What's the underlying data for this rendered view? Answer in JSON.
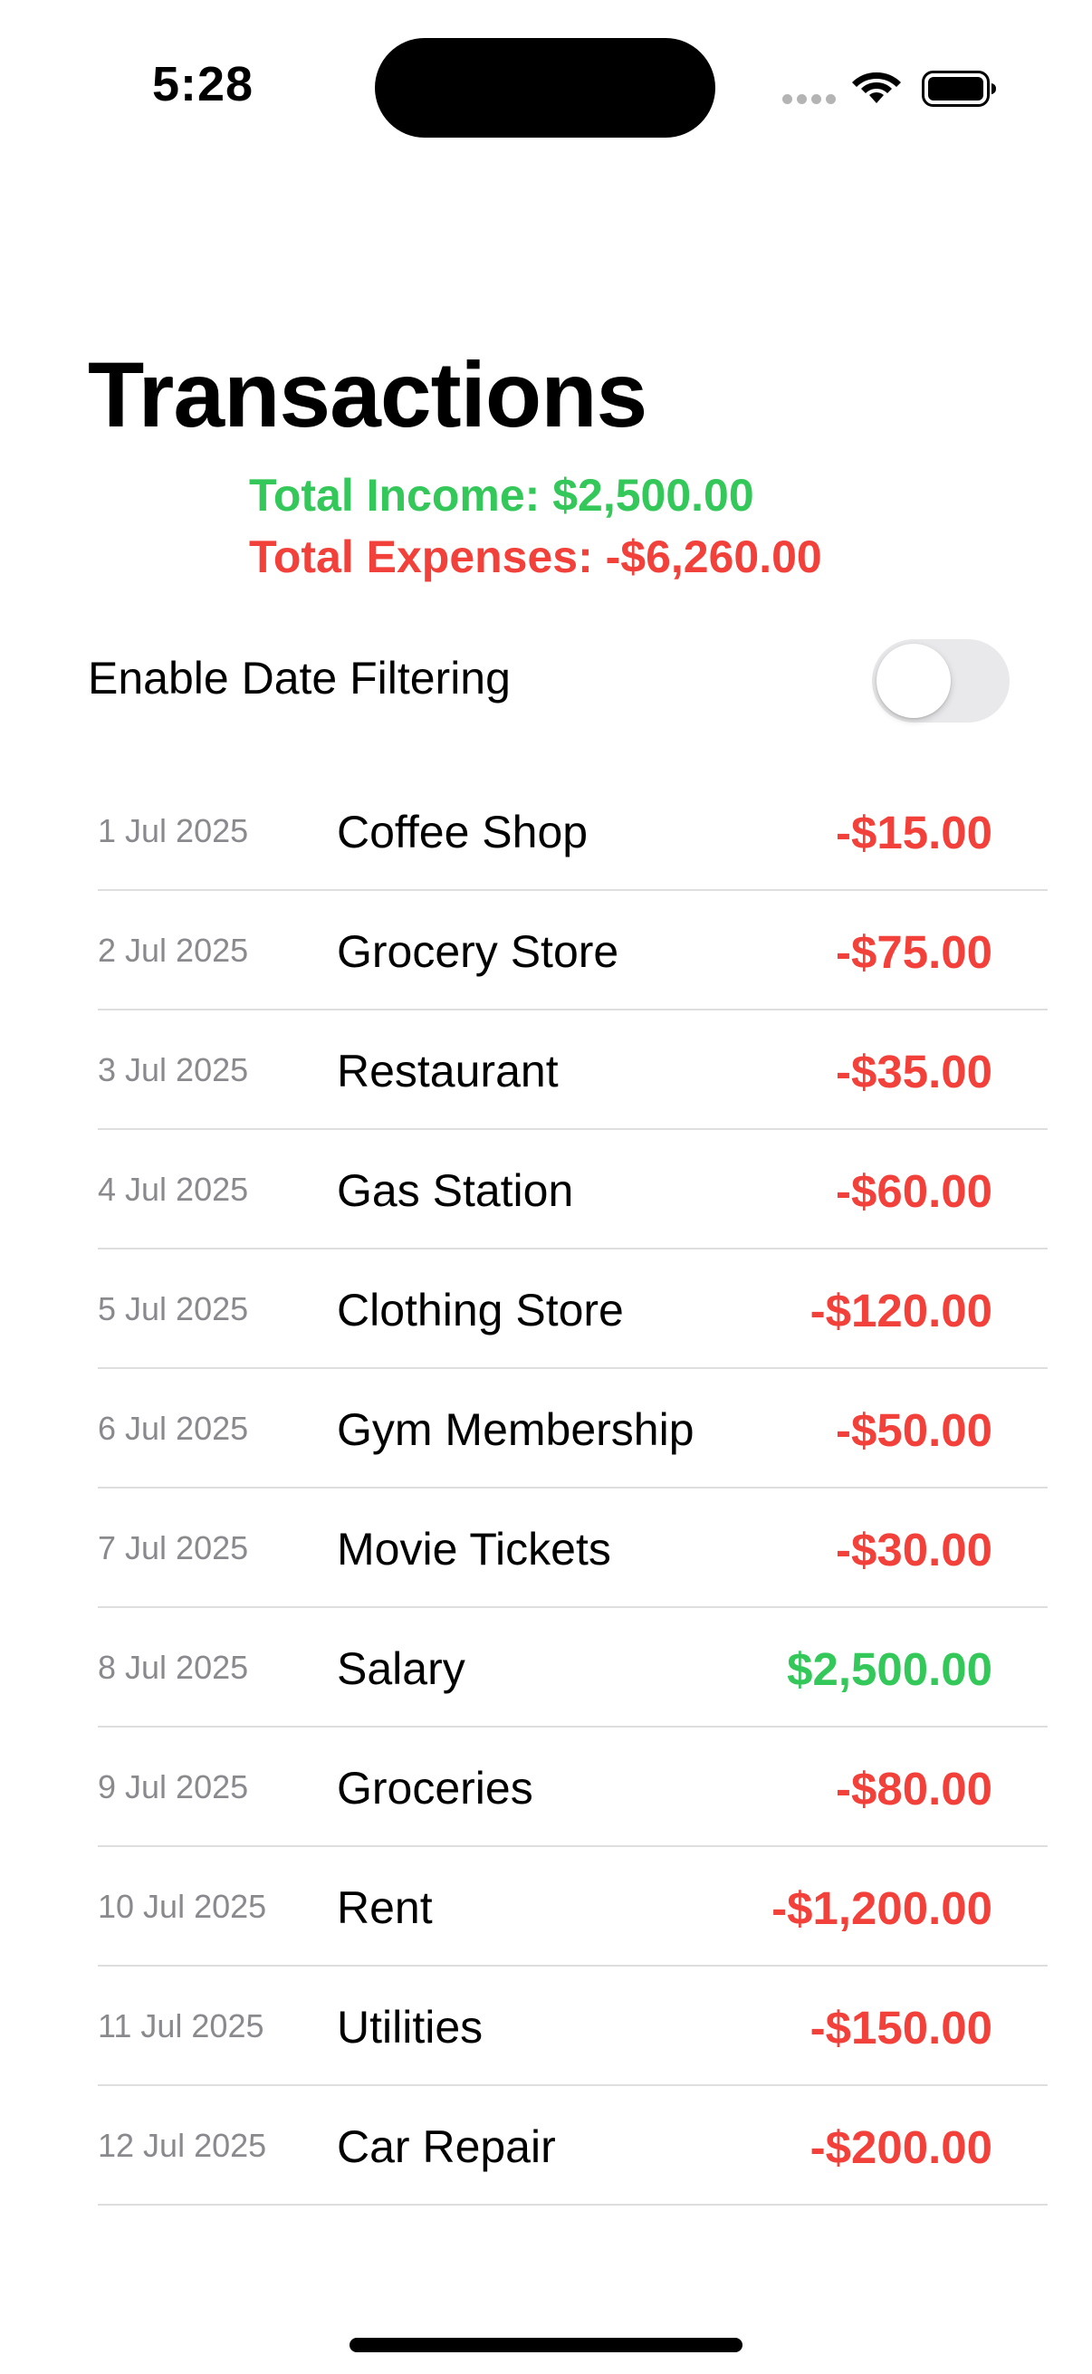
{
  "status_bar": {
    "time": "5:28",
    "icons": [
      "signal-dots-icon",
      "wifi-icon",
      "battery-icon"
    ]
  },
  "header": {
    "title": "Transactions",
    "total_income": "Total Income: $2,500.00",
    "total_expenses": "Total Expenses: -$6,260.00"
  },
  "filter": {
    "label": "Enable Date Filtering",
    "enabled": false
  },
  "transactions": [
    {
      "date": "1 Jul 2025",
      "description": "Coffee Shop",
      "amount": "-$15.00",
      "type": "expense"
    },
    {
      "date": "2 Jul 2025",
      "description": "Grocery Store",
      "amount": "-$75.00",
      "type": "expense"
    },
    {
      "date": "3 Jul 2025",
      "description": "Restaurant",
      "amount": "-$35.00",
      "type": "expense"
    },
    {
      "date": "4 Jul 2025",
      "description": "Gas Station",
      "amount": "-$60.00",
      "type": "expense"
    },
    {
      "date": "5 Jul 2025",
      "description": "Clothing Store",
      "amount": "-$120.00",
      "type": "expense"
    },
    {
      "date": "6 Jul 2025",
      "description": "Gym Membership",
      "amount": "-$50.00",
      "type": "expense"
    },
    {
      "date": "7 Jul 2025",
      "description": "Movie Tickets",
      "amount": "-$30.00",
      "type": "expense"
    },
    {
      "date": "8 Jul 2025",
      "description": "Salary",
      "amount": "$2,500.00",
      "type": "income"
    },
    {
      "date": "9 Jul 2025",
      "description": "Groceries",
      "amount": "-$80.00",
      "type": "expense"
    },
    {
      "date": "10 Jul 2025",
      "description": "Rent",
      "amount": "-$1,200.00",
      "type": "expense"
    },
    {
      "date": "11 Jul 2025",
      "description": "Utilities",
      "amount": "-$150.00",
      "type": "expense"
    },
    {
      "date": "12 Jul 2025",
      "description": "Car Repair",
      "amount": "-$200.00",
      "type": "expense"
    }
  ],
  "colors": {
    "income": "#34c759",
    "expense": "#f2413a",
    "date_text": "#8a8a8e",
    "separator": "#dedede",
    "toggle_off": "#e9e9eb"
  }
}
